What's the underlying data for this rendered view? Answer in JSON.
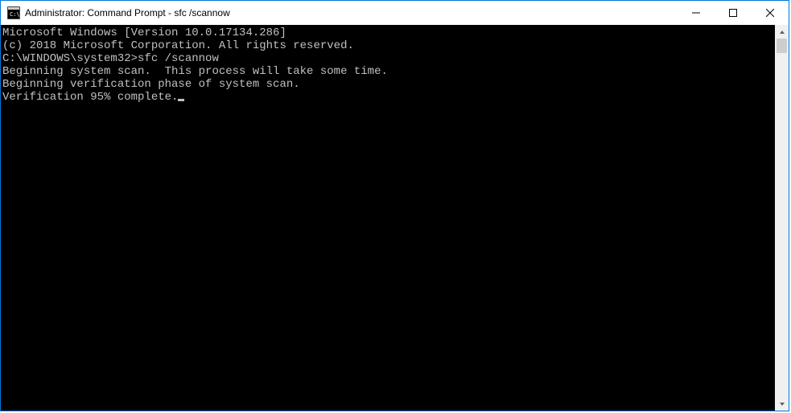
{
  "titlebar": {
    "title": "Administrator: Command Prompt - sfc  /scannow"
  },
  "console": {
    "lines": [
      "Microsoft Windows [Version 10.0.17134.286]",
      "(c) 2018 Microsoft Corporation. All rights reserved.",
      "",
      "C:\\WINDOWS\\system32>sfc /scannow",
      "",
      "Beginning system scan.  This process will take some time.",
      "",
      "Beginning verification phase of system scan.",
      "Verification 95% complete."
    ]
  }
}
